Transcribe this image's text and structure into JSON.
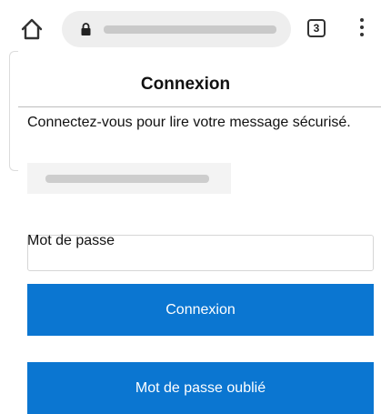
{
  "browser": {
    "tab_count": "3"
  },
  "page": {
    "title": "Connexion",
    "intro": "Connectez-vous pour lire votre message sécurisé.",
    "password_label": "Mot de passe",
    "login_button": "Connexion",
    "forgot_button": "Mot de passe oublié"
  },
  "colors": {
    "primary": "#0b76d1"
  },
  "icons": {
    "home": "home-icon",
    "lock": "lock-icon",
    "tabs": "tab-switcher-icon",
    "menu": "more-vertical-icon"
  }
}
